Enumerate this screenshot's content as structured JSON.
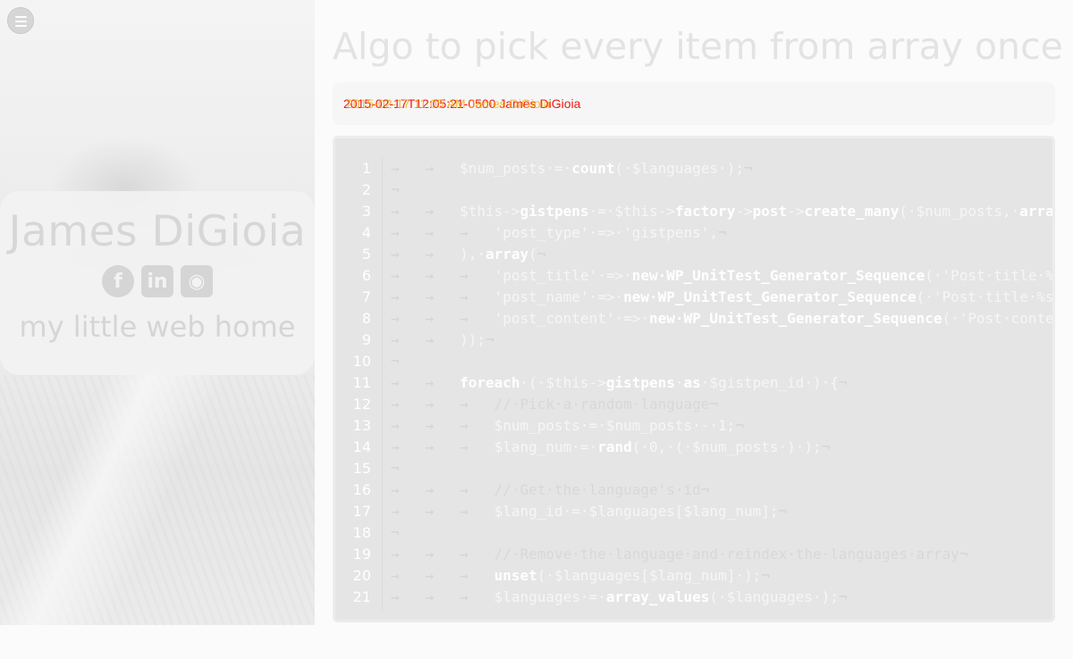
{
  "sidebar": {
    "menu_icon": "hamburger-menu-icon",
    "name": "James DiGioia",
    "social": [
      {
        "icon": "facebook-icon",
        "glyph": "f"
      },
      {
        "icon": "linkedin-icon",
        "glyph": "in"
      },
      {
        "icon": "github-icon",
        "glyph": "◉"
      }
    ],
    "tagline": "my little web home"
  },
  "post": {
    "title": "Algo to pick every item from array once",
    "meta": "2015-02-17T12:05:21-0500 James DiGioia",
    "meta_ghost": "2015-02-17 11:05 AM James DiGioia"
  },
  "code": {
    "line_numbers": [
      "1",
      "2",
      "3",
      "4",
      "5",
      "6",
      "7",
      "8",
      "9",
      "10",
      "11",
      "12",
      "13",
      "14",
      "15",
      "16",
      "17",
      "18",
      "19",
      "20",
      "21"
    ],
    "lines": [
      [
        [
          "ws",
          "→   →   "
        ],
        [
          "t",
          "$num_posts·=·"
        ],
        [
          "b",
          "count"
        ],
        [
          "t",
          "(·$languages·);"
        ],
        [
          "ws",
          "¬"
        ]
      ],
      [
        [
          "ws",
          "¬"
        ]
      ],
      [
        [
          "ws",
          "→   →   "
        ],
        [
          "t",
          "$this->"
        ],
        [
          "b",
          "gistpens"
        ],
        [
          "t",
          "·=·$this->"
        ],
        [
          "b",
          "factory"
        ],
        [
          "t",
          "->"
        ],
        [
          "b",
          "post"
        ],
        [
          "t",
          "->"
        ],
        [
          "b",
          "create_many"
        ],
        [
          "t",
          "(·$num_posts,·"
        ],
        [
          "b",
          "array"
        ],
        [
          "t",
          "("
        ]
      ],
      [
        [
          "ws",
          "→   →   →   "
        ],
        [
          "t",
          "'post_type'·=>·'gistpens',"
        ],
        [
          "ws",
          "¬"
        ]
      ],
      [
        [
          "ws",
          "→   →   "
        ],
        [
          "t",
          "),·"
        ],
        [
          "b",
          "array"
        ],
        [
          "t",
          "("
        ],
        [
          "ws",
          "¬"
        ]
      ],
      [
        [
          "ws",
          "→   →   →   "
        ],
        [
          "t",
          "'post_title'·=>·"
        ],
        [
          "b",
          "new·WP_UnitTest_Generator_Sequence"
        ],
        [
          "t",
          "(·'Post·title·%s'·),"
        ]
      ],
      [
        [
          "ws",
          "→   →   →   "
        ],
        [
          "t",
          "'post_name'·=>·"
        ],
        [
          "b",
          "new·WP_UnitTest_Generator_Sequence"
        ],
        [
          "t",
          "(·'Post·title·%s'·),"
        ]
      ],
      [
        [
          "ws",
          "→   →   →   "
        ],
        [
          "t",
          "'post_content'·=>·"
        ],
        [
          "b",
          "new·WP_UnitTest_Generator_Sequence"
        ],
        [
          "t",
          "(·'Post·content·%s'·)"
        ]
      ],
      [
        [
          "ws",
          "→   →   "
        ],
        [
          "t",
          "));"
        ],
        [
          "ws",
          "¬"
        ]
      ],
      [
        [
          "ws",
          "¬"
        ]
      ],
      [
        [
          "ws",
          "→   →   "
        ],
        [
          "b",
          "foreach"
        ],
        [
          "t",
          "·(·$this->"
        ],
        [
          "b",
          "gistpens"
        ],
        [
          "t",
          "·"
        ],
        [
          "b",
          "as"
        ],
        [
          "t",
          "·$gistpen_id·)·{"
        ],
        [
          "ws",
          "¬"
        ]
      ],
      [
        [
          "ws",
          "→   →   →   "
        ],
        [
          "cm",
          "//·Pick·a·random·language"
        ],
        [
          "ws",
          "¬"
        ]
      ],
      [
        [
          "ws",
          "→   →   →   "
        ],
        [
          "t",
          "$num_posts·=·$num_posts·-·1;"
        ],
        [
          "ws",
          "¬"
        ]
      ],
      [
        [
          "ws",
          "→   →   →   "
        ],
        [
          "t",
          "$lang_num·=·"
        ],
        [
          "b",
          "rand"
        ],
        [
          "t",
          "(·0,·(·$num_posts·)·);"
        ],
        [
          "ws",
          "¬"
        ]
      ],
      [
        [
          "ws",
          "¬"
        ]
      ],
      [
        [
          "ws",
          "→   →   →   "
        ],
        [
          "cm",
          "//·Get·the·language's·id"
        ],
        [
          "ws",
          "¬"
        ]
      ],
      [
        [
          "ws",
          "→   →   →   "
        ],
        [
          "t",
          "$lang_id·=·$languages[$lang_num];"
        ],
        [
          "ws",
          "¬"
        ]
      ],
      [
        [
          "ws",
          "¬"
        ]
      ],
      [
        [
          "ws",
          "→   →   →   "
        ],
        [
          "cm",
          "//·Remove·the·language·and·reindex·the·languages·array"
        ],
        [
          "ws",
          "¬"
        ]
      ],
      [
        [
          "ws",
          "→   →   →   "
        ],
        [
          "b",
          "unset"
        ],
        [
          "t",
          "(·$languages[$lang_num]·);"
        ],
        [
          "ws",
          "¬"
        ]
      ],
      [
        [
          "ws",
          "→   →   →   "
        ],
        [
          "t",
          "$languages·=·"
        ],
        [
          "b",
          "array_values"
        ],
        [
          "t",
          "(·$languages·);"
        ],
        [
          "ws",
          "¬"
        ]
      ]
    ]
  }
}
